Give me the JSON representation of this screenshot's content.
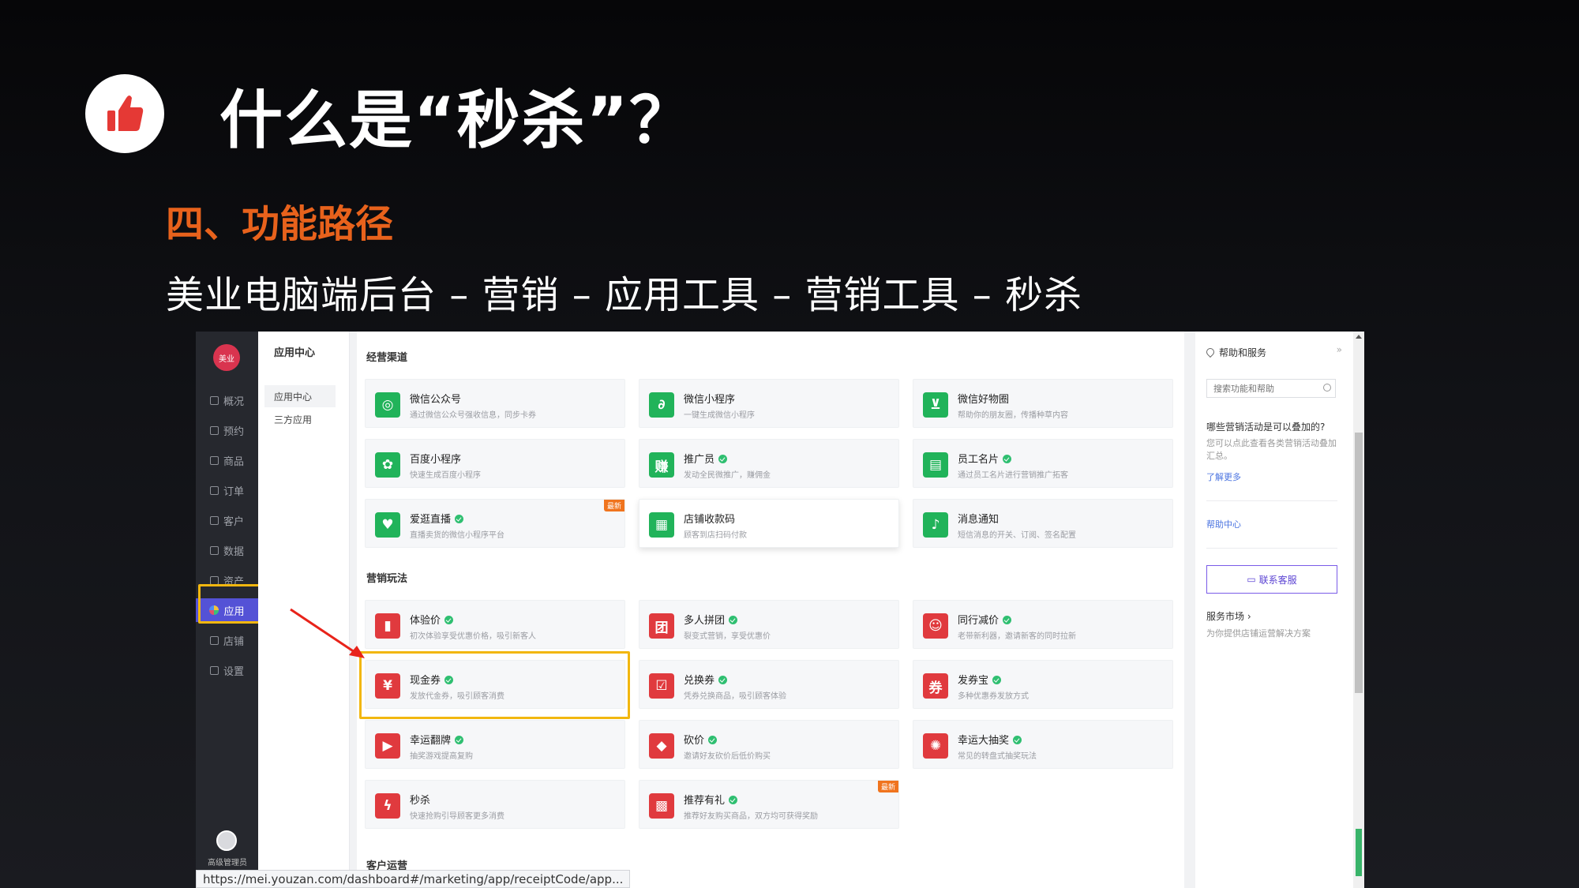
{
  "slide": {
    "title": "什么是“秒杀”？",
    "subtitle": "四、功能路径",
    "path": "美业电脑端后台 – 营销 – 应用工具 – 营销工具 – 秒杀"
  },
  "sidebar": {
    "brand": "美业",
    "items": [
      {
        "label": "概况"
      },
      {
        "label": "预约"
      },
      {
        "label": "商品"
      },
      {
        "label": "订单"
      },
      {
        "label": "客户"
      },
      {
        "label": "数据"
      },
      {
        "label": "资产"
      },
      {
        "label": "应用"
      },
      {
        "label": "店铺"
      },
      {
        "label": "设置"
      }
    ],
    "active_index": 7,
    "user_role": "高级管理员"
  },
  "subnav": {
    "title": "应用中心",
    "items": [
      {
        "label": "应用中心"
      },
      {
        "label": "三方应用"
      }
    ]
  },
  "sections": [
    {
      "title": "经营渠道",
      "cards": [
        {
          "name": "微信公众号",
          "desc": "通过微信公众号强收信息，同步卡券",
          "icon": "wechat-icon",
          "color": "#21b35a"
        },
        {
          "name": "微信小程序",
          "desc": "一键生成微信小程序",
          "icon": "miniprogram-icon",
          "color": "#21b35a"
        },
        {
          "name": "微信好物圈",
          "desc": "帮助你的朋友圈，传播种草内容",
          "icon": "cart-icon",
          "color": "#21b35a"
        },
        {
          "name": "百度小程序",
          "desc": "快速生成百度小程序",
          "icon": "baidu-icon",
          "color": "#21b35a"
        },
        {
          "name": "推广员",
          "desc": "发动全民微推广，赚佣金",
          "icon": "earn-icon",
          "color": "#21b35a",
          "ok": true
        },
        {
          "name": "员工名片",
          "desc": "通过员工名片进行营销推广拓客",
          "icon": "card-icon",
          "color": "#21b35a",
          "ok": true
        },
        {
          "name": "爱逛直播",
          "desc": "直播卖货的微信小程序平台",
          "icon": "live-icon",
          "color": "#21b35a",
          "ok": true,
          "tag": "最新"
        },
        {
          "name": "店铺收款码",
          "desc": "顾客到店扫码付款",
          "icon": "qrcode-icon",
          "color": "#21b35a"
        },
        {
          "name": "消息通知",
          "desc": "短信消息的开关、订阅、签名配置",
          "icon": "bell-icon",
          "color": "#21b35a"
        }
      ]
    },
    {
      "title": "营销玩法",
      "cards": [
        {
          "name": "体验价",
          "desc": "初次体验享受优惠价格，吸引新客人",
          "icon": "bag-icon",
          "color": "#e03a3e",
          "ok": true
        },
        {
          "name": "多人拼团",
          "desc": "裂变式营销，享受优惠价",
          "icon": "group-icon",
          "color": "#e03a3e",
          "ok": true
        },
        {
          "name": "同行减价",
          "desc": "老带新利器，邀请新客的同时拉新",
          "icon": "users-icon",
          "color": "#e03a3e",
          "ok": true
        },
        {
          "name": "现金券",
          "desc": "发放代金券，吸引顾客消费",
          "icon": "coupon-icon",
          "color": "#e03a3e",
          "ok": true
        },
        {
          "name": "兑换券",
          "desc": "凭券兑换商品，吸引顾客体验",
          "icon": "exchange-icon",
          "color": "#e03a3e",
          "ok": true
        },
        {
          "name": "发券宝",
          "desc": "多种优惠券发放方式",
          "icon": "ticket-icon",
          "color": "#e03a3e",
          "ok": true
        },
        {
          "name": "幸运翻牌",
          "desc": "抽奖游戏提高复购",
          "icon": "flip-icon",
          "color": "#e03a3e",
          "ok": true
        },
        {
          "name": "砍价",
          "desc": "邀请好友砍价后低价购买",
          "icon": "tag-icon",
          "color": "#e03a3e",
          "ok": true
        },
        {
          "name": "幸运大抽奖",
          "desc": "常见的转盘式抽奖玩法",
          "icon": "wheel-icon",
          "color": "#e03a3e",
          "ok": true
        },
        {
          "name": "秒杀",
          "desc": "快速抢购引导顾客更多消费",
          "icon": "flash-icon",
          "color": "#e03a3e"
        },
        {
          "name": "推荐有礼",
          "desc": "推荐好友购买商品，双方均可获得奖励",
          "icon": "gift-icon",
          "color": "#e03a3e",
          "ok": true,
          "tag": "最新"
        }
      ]
    },
    {
      "title": "客户运营"
    }
  ],
  "help": {
    "title": "帮助和服务",
    "search_placeholder": "搜索功能和帮助",
    "question": "哪些营销活动是可以叠加的?",
    "answer": "您可以点此查看各类营销活动叠加汇总。",
    "learn_more": "了解更多",
    "help_center": "帮助中心",
    "contact": "联系客服",
    "market": "服务市场 ›",
    "market_desc": "为你提供店铺运营解决方案"
  },
  "status_url": "https://mei.youzan.com/dashboard#/marketing/app/receiptCode/app...",
  "colors": {
    "accent_orange": "#e8621c",
    "highlight": "#f2b70f",
    "nav_active": "#5452d6"
  }
}
